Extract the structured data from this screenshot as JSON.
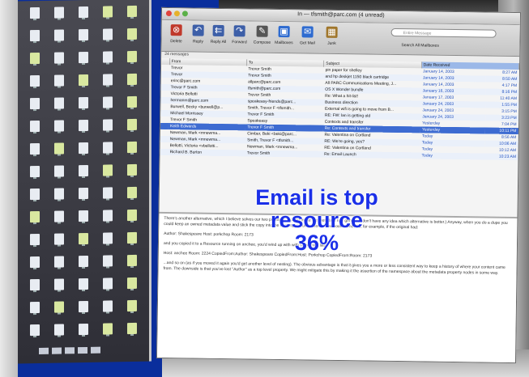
{
  "mail": {
    "window_title": "In — tfsmith@parc.com (4 unread)",
    "toolbar": [
      {
        "label": "Delete",
        "icon": "delete-icon",
        "glyph": "⊗",
        "color": "#c0392b"
      },
      {
        "label": "Reply",
        "icon": "reply-icon",
        "glyph": "↶",
        "color": "#3d5fa8"
      },
      {
        "label": "Reply All",
        "icon": "reply-all-icon",
        "glyph": "⇇",
        "color": "#3d5fa8"
      },
      {
        "label": "Forward",
        "icon": "forward-icon",
        "glyph": "↷",
        "color": "#3d5fa8"
      },
      {
        "label": "Compose",
        "icon": "compose-icon",
        "glyph": "✎",
        "color": "#555"
      },
      {
        "label": "Mailboxes",
        "icon": "mailboxes-icon",
        "glyph": "▣",
        "color": "#2e6bd0"
      },
      {
        "label": "Get Mail",
        "icon": "get-mail-icon",
        "glyph": "✉",
        "color": "#2e6bd0"
      },
      {
        "label": "Junk",
        "icon": "junk-icon",
        "glyph": "▦",
        "color": "#a0762b"
      }
    ],
    "search_placeholder": "Entire Message",
    "search_label": "Search All Mailboxes",
    "message_count": "24 messages",
    "columns": [
      "From",
      "To",
      "Subject",
      "Date Received"
    ],
    "rows": [
      {
        "from": "Trevor",
        "to": "Trevor Smith",
        "subject": "pin paper for shelley",
        "date": "January 14, 2003",
        "time": "8:27 AM"
      },
      {
        "from": "Trevor",
        "to": "Trevor Smith",
        "subject": "and hp deskjet 1150 black cartridge",
        "date": "January 14, 2003",
        "time": "8:50 AM"
      },
      {
        "from": "erinc@parc.com",
        "to": "allparc@parc.com",
        "subject": "All PARC Communications Meeting, J...",
        "date": "January 14, 2003",
        "time": "4:17 PM"
      },
      {
        "from": "Trevor F Smith",
        "to": "tfsmith@parc.com",
        "subject": "OS X Wonder bundle",
        "date": "January 16, 2003",
        "time": "8:16 PM"
      },
      {
        "from": "Victoria Bellotti",
        "to": "Trevor Smith",
        "subject": "Re: What a hit-list!",
        "date": "January 17, 2003",
        "time": "11:40 AM"
      },
      {
        "from": "hermanm@parc.com",
        "to": "speakeasy-friends@parc...",
        "subject": "Business direction",
        "date": "January 24, 2003",
        "time": "1:55 PM"
      },
      {
        "from": "Burwell, Becky <burwell@p...",
        "to": "Smith, Trevor F <tfsmith...",
        "subject": "External wifi is going to move from B...",
        "date": "January 24, 2003",
        "time": "3:15 PM"
      },
      {
        "from": "Michael Morrissey",
        "to": "Trevor F Smith",
        "subject": "RE: FW: lan is getting old",
        "date": "January 24, 2003",
        "time": "3:23 PM"
      },
      {
        "from": "Trevor F Smith",
        "to": "Speakeasy",
        "subject": "Contexts and transfer",
        "date": "Yesterday",
        "time": "7:04 PM"
      },
      {
        "from": "Keith Edwards",
        "to": "Trevor F Smith",
        "subject": "Re: Contexts and transfer",
        "date": "Yesterday",
        "time": "10:11 PM",
        "selected": true
      },
      {
        "from": "Newman, Mark <mnewma...",
        "to": "Cimber, Beki <beki@parc...",
        "subject": "Re: Valentina on Cortland",
        "date": "Today",
        "time": "8:56 AM"
      },
      {
        "from": "Newman, Mark <mnewma...",
        "to": "Smith, Trevor F <tfsmith...",
        "subject": "RE: We're going, yes?",
        "date": "Today",
        "time": "10:06 AM"
      },
      {
        "from": "Bellotti, Victoria <vbellotti...",
        "to": "Newman, Mark <mnewma...",
        "subject": "RE: Valentina on Cortland",
        "date": "Today",
        "time": "10:12 AM"
      },
      {
        "from": "Richard B. Burton",
        "to": "Trevor Smith",
        "subject": "Re: Email Launch",
        "date": "Today",
        "time": "10:23 AM"
      }
    ],
    "preview_paragraphs": [
      "There's another alternative, which I believe solves our two problems. I could make the metadata rule generic; I don't have any idea which alternative is better.) Anyway, when you do a dupe you could keep an owned metadata value and stick the copy into the namespace under some new node name. So, for example, if the original had:",
      "Author: Shakespeare  Host: porkchop  Room: 2173",
      "and you copied it to a Resource running on anchee, you'd wind up with with something like:",
      "Host: anchee  Room: 2224  CopiedFrom:Author: Shakespeare  CopiedFrom:Host: Porkchop  CopiedFrom:Room: 2173",
      "...and so on (as if you moved it again you'd get another level of nesting). The obvious advantage is that it gives you a more or less consistent way to keep a history of where your content came from. The downside is that you've lost \"Author\" as a top level property. We might mitigate this by making it the assertion of the namespace about the metadata property nodes in some way."
    ]
  },
  "overlay": {
    "line1": "Email is top",
    "line2": "resource",
    "line3": "36%"
  },
  "colors": {
    "background": "#0a2e9c",
    "overlay_text": "#1a2fe8",
    "selected_row": "#3d6bd1"
  }
}
